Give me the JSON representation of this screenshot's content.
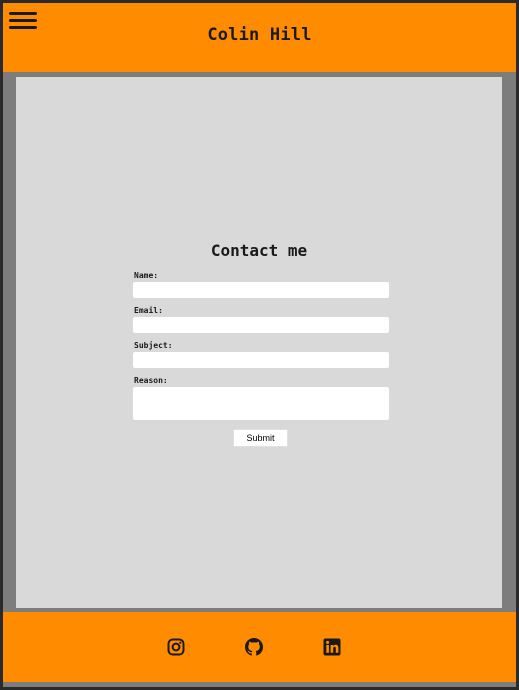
{
  "header": {
    "title": "Colin Hill",
    "menu_icon": "hamburger-menu-icon",
    "background": "#ff8c00"
  },
  "contact": {
    "heading": "Contact me",
    "fields": [
      {
        "label": "Name:",
        "value": "",
        "type": "text"
      },
      {
        "label": "Email:",
        "value": "",
        "type": "text"
      },
      {
        "label": "Subject:",
        "value": "",
        "type": "text"
      },
      {
        "label": "Reason:",
        "value": "",
        "type": "textarea"
      }
    ],
    "submit_label": "Submit"
  },
  "footer": {
    "background": "#ff8c00",
    "social_links": [
      {
        "icon": "instagram-icon"
      },
      {
        "icon": "github-icon"
      },
      {
        "icon": "linkedin-icon"
      }
    ]
  },
  "colors": {
    "accent": "#ff8c00",
    "panel": "#d9d9d9",
    "frame": "#7d7d7d",
    "text": "#1a1a1a"
  }
}
